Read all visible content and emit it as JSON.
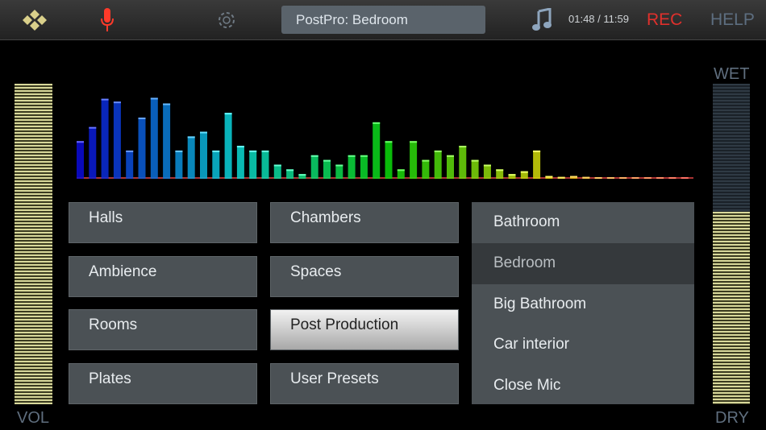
{
  "header": {
    "preset_name": "PostPro: Bedroom",
    "time": "01:48 / 11:59",
    "rec_label": "REC",
    "help_label": "HELP"
  },
  "meters": {
    "vol_label": "VOL",
    "wet_label": "WET",
    "dry_label": "DRY",
    "volume_level": 1.0,
    "wet_dry_level": 0.6
  },
  "categories": [
    {
      "label": "Halls"
    },
    {
      "label": "Chambers"
    },
    {
      "label": "Ambience"
    },
    {
      "label": "Spaces"
    },
    {
      "label": "Rooms"
    },
    {
      "label": "Post Production",
      "selected": true
    },
    {
      "label": "Plates"
    },
    {
      "label": "User Presets"
    }
  ],
  "presets": [
    {
      "label": "Bathroom"
    },
    {
      "label": "Bedroom",
      "selected": true
    },
    {
      "label": "Big Bathroom"
    },
    {
      "label": "Car interior"
    },
    {
      "label": "Close Mic"
    }
  ],
  "spectrum": {
    "levels": [
      0.4,
      0.55,
      0.85,
      0.82,
      0.3,
      0.65,
      0.86,
      0.8,
      0.3,
      0.45,
      0.5,
      0.3,
      0.7,
      0.35,
      0.3,
      0.3,
      0.15,
      0.1,
      0.05,
      0.25,
      0.2,
      0.15,
      0.25,
      0.25,
      0.6,
      0.4,
      0.1,
      0.4,
      0.2,
      0.3,
      0.25,
      0.35,
      0.2,
      0.15,
      0.1,
      0.05,
      0.08,
      0.3,
      0.03,
      0.02,
      0.03,
      0.02,
      0.01,
      0.01,
      0.01,
      0.01,
      0.01,
      0.01,
      0.01,
      0.01
    ]
  }
}
